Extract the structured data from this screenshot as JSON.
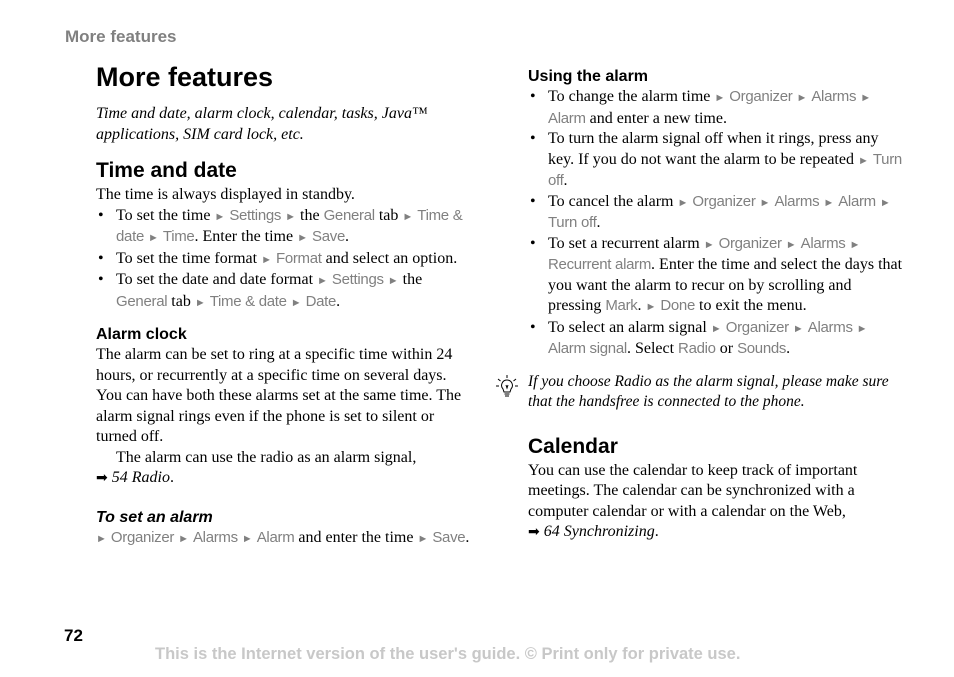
{
  "running_head": "More features",
  "title": "More features",
  "intro": "Time and date, alarm clock, calendar, tasks, Java™ applications, SIM card lock, etc.",
  "time_and_date": {
    "heading": "Time and date",
    "lead": "The time is always displayed in standby.",
    "bullets": [
      {
        "t1": "To set the time ",
        "m1": "Settings",
        "t2": " the ",
        "m2": "General",
        "t3": " tab ",
        "m3": "Time & date",
        "m4": "Time",
        "t4": ". Enter the time ",
        "m5": "Save",
        "t5": "."
      },
      {
        "t1": "To set the time format ",
        "m1": "Format",
        "t2": " and select an option."
      },
      {
        "t1": "To set the date and date format ",
        "m1": "Settings",
        "t2": " the ",
        "m2": "General",
        "t3": " tab ",
        "m3": "Time & date",
        "m4": "Date",
        "t4": "."
      }
    ]
  },
  "alarm_clock": {
    "heading": "Alarm clock",
    "body": "The alarm can be set to ring at a specific time within 24 hours, or recurrently at a specific time on several days. You can have both these alarms set at the same time. The alarm signal rings even if the phone is set to silent or turned off.",
    "radio_note": "The alarm can use the radio as an alarm signal,",
    "radio_ref": "54 Radio",
    "set_heading": "To set an alarm",
    "set_steps": {
      "m1": "Organizer",
      "m2": "Alarms",
      "m3": "Alarm",
      "t1": " and enter the time ",
      "m4": "Save",
      "t2": "."
    }
  },
  "using_alarm": {
    "heading": "Using the alarm",
    "bullets": [
      {
        "t1": "To change the alarm time ",
        "m1": "Organizer",
        "m2": "Alarms",
        "m3": "Alarm",
        "t2": " and enter a new time."
      },
      {
        "t1": "To turn the alarm signal off when it rings, press any key. If you do not want the alarm to be repeated ",
        "m1": "Turn off",
        "t2": "."
      },
      {
        "t1": "To cancel the alarm ",
        "m1": "Organizer",
        "m2": "Alarms",
        "m3": "Alarm",
        "m4": "Turn off",
        "t2": "."
      },
      {
        "t1": "To set a recurrent alarm ",
        "m1": "Organizer",
        "m2": "Alarms",
        "m3": "Recurrent alarm",
        "t2": ". Enter the time and select the days that you want the alarm to recur on by scrolling and pressing ",
        "m4": "Mark",
        "t3": ". ",
        "m5": "Done",
        "t4": " to exit the menu."
      },
      {
        "t1": "To select an alarm signal ",
        "m1": "Organizer",
        "m2": "Alarms",
        "m3": "Alarm signal",
        "t2": ". Select ",
        "m4": "Radio",
        "t3": " or ",
        "m5": "Sounds",
        "t4": "."
      }
    ],
    "tip": "If you choose Radio as the alarm signal, please make sure that the handsfree is connected to the phone."
  },
  "calendar": {
    "heading": "Calendar",
    "body": "You can use the calendar to keep track of important meetings. The calendar can be synchronized with a computer calendar or with a calendar on the Web,",
    "ref": "64 Synchronizing"
  },
  "icons": {
    "menu_arrow": "►",
    "ref_arrow": "➡",
    "tip": "lightbulb-icon"
  },
  "page_number": "72",
  "footer": "This is the Internet version of the user's guide. © Print only for private use."
}
